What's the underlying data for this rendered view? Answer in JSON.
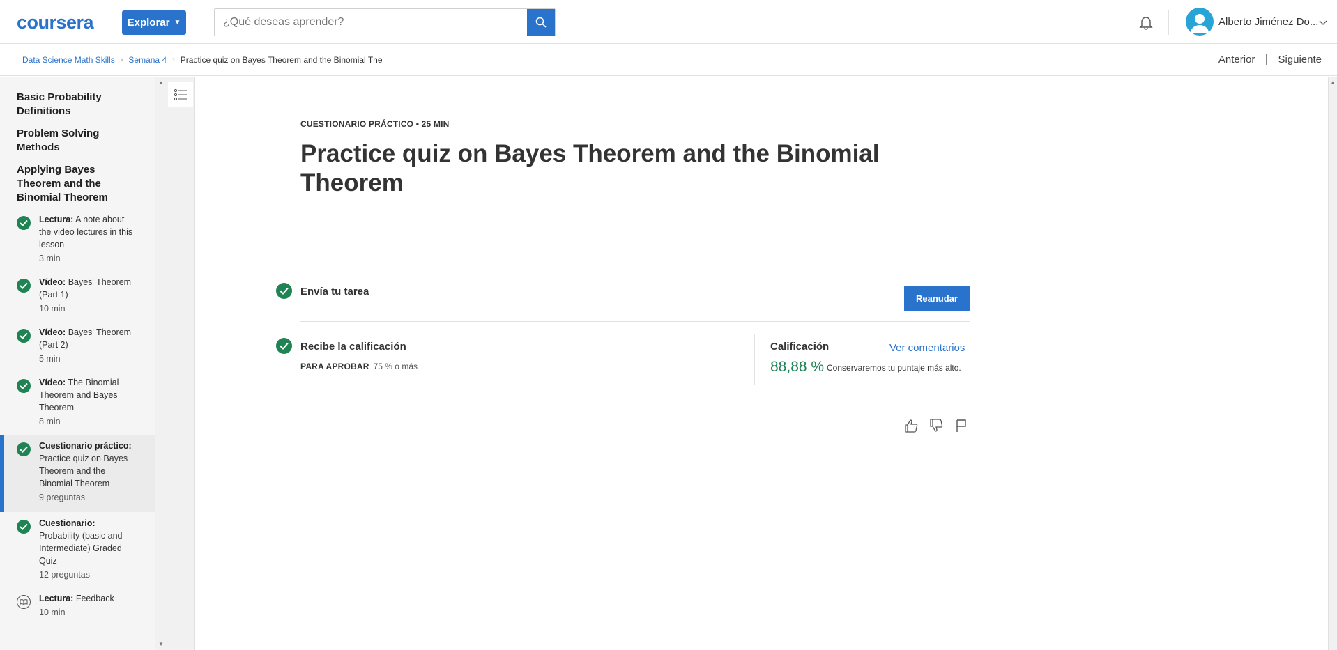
{
  "header": {
    "logo": "coursera",
    "explore_label": "Explorar",
    "search_placeholder": "¿Qué deseas aprender?",
    "user_name": "Alberto Jiménez Do...",
    "icons": {
      "search": "search-icon",
      "bell": "bell-icon",
      "avatar": "user-avatar-icon",
      "chevron": "chevron-down-icon"
    }
  },
  "breadcrumb": {
    "items": [
      "Data Science Math Skills",
      "Semana 4",
      "Practice quiz on Bayes Theorem and the Binomial The"
    ],
    "prev_label": "Anterior",
    "next_label": "Siguiente"
  },
  "sidebar": {
    "headings": [
      "Basic Probability Definitions",
      "Problem Solving Methods",
      "Applying Bayes Theorem and the Binomial Theorem"
    ],
    "items": [
      {
        "type": "Lectura:",
        "title": "A note about the video lectures in this lesson",
        "meta": "3 min",
        "status": "completed"
      },
      {
        "type": "Vídeo:",
        "title": "Bayes' Theorem (Part 1)",
        "meta": "10 min",
        "status": "completed"
      },
      {
        "type": "Vídeo:",
        "title": "Bayes' Theorem (Part 2)",
        "meta": "5 min",
        "status": "completed"
      },
      {
        "type": "Vídeo:",
        "title": "The Binomial Theorem and Bayes Theorem",
        "meta": "8 min",
        "status": "completed"
      },
      {
        "type": "Cuestionario práctico:",
        "title": "Practice quiz on Bayes Theorem and the Binomial Theorem",
        "meta": "9 preguntas",
        "status": "completed",
        "active": true
      },
      {
        "type": "Cuestionario:",
        "title": "Probability (basic and Intermediate) Graded Quiz",
        "meta": "12 preguntas",
        "status": "completed"
      },
      {
        "type": "Lectura:",
        "title": "Feedback",
        "meta": "10 min",
        "status": "reading"
      }
    ]
  },
  "main": {
    "eyebrow": "CUESTIONARIO PRÁCTICO • 25 MIN",
    "title": "Practice quiz on Bayes Theorem and the Binomial Theorem",
    "step1_label": "Envía tu tarea",
    "resume_label": "Reanudar",
    "step2_label": "Recibe la calificación",
    "pass_key": "PARA APROBAR",
    "pass_value": "75 % o más",
    "grade_label": "Calificación",
    "view_feedback": "Ver comentarios",
    "grade_value": "88,88 %",
    "grade_note": "Conservaremos tu puntaje más alto."
  },
  "colors": {
    "accent": "#2a73cc",
    "success": "#1f8354"
  }
}
